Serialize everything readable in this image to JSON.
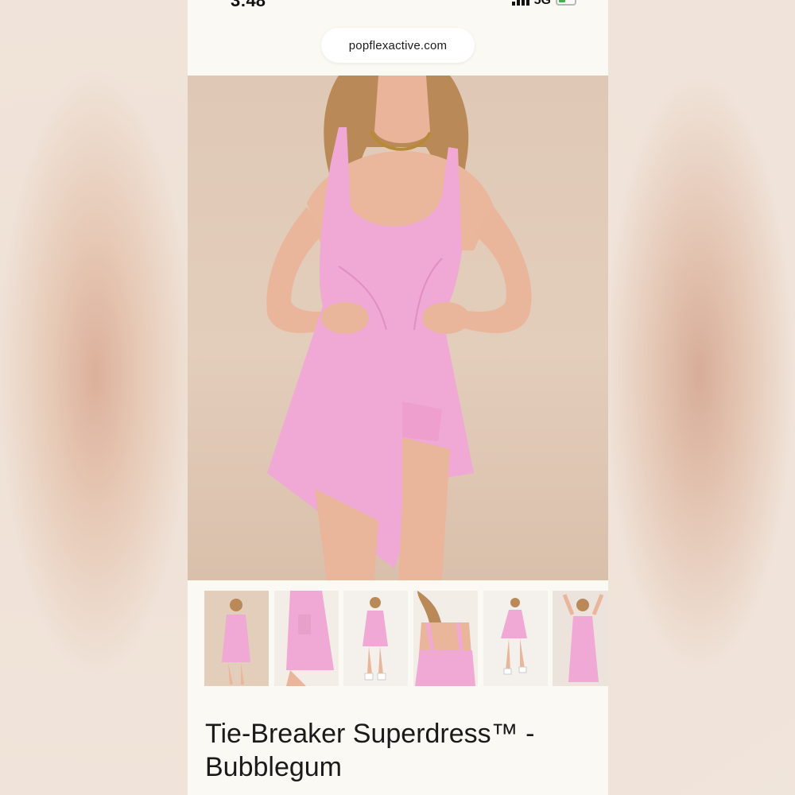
{
  "status_bar": {
    "time": "3:48",
    "network": "5G"
  },
  "browser": {
    "url": "popflexactive.com"
  },
  "product": {
    "title_line1": "Tie-Breaker Superdress™ -",
    "title_line2": "Bubblegum",
    "main_image": "model-in-pink-dress",
    "thumbnails": [
      {
        "name": "thumbnail-front-full",
        "selected": true
      },
      {
        "name": "thumbnail-side-pocket",
        "selected": false
      },
      {
        "name": "thumbnail-front-sneakers",
        "selected": false
      },
      {
        "name": "thumbnail-back-straps",
        "selected": false
      },
      {
        "name": "thumbnail-walking",
        "selected": false
      },
      {
        "name": "thumbnail-arms-up",
        "selected": false
      }
    ]
  },
  "colors": {
    "dress_pink": "#f0a8d4",
    "background_beige": "#e0c9b6",
    "page_bg": "#fbf9f3"
  }
}
